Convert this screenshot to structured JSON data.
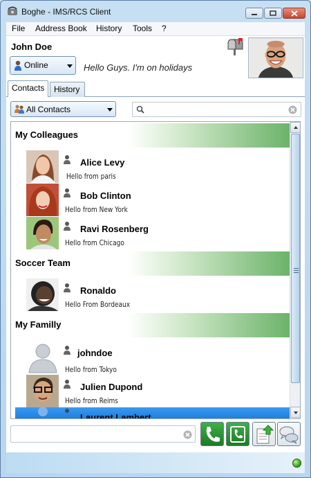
{
  "window": {
    "title": "Boghe - IMS/RCS Client"
  },
  "menu": {
    "items": [
      "File",
      "Address Book",
      "History",
      "Tools",
      "?"
    ]
  },
  "user": {
    "name": "John Doe",
    "presence": "Online",
    "mood": "Hello Guys. I'm on holidays"
  },
  "tabs": [
    "Contacts",
    "History"
  ],
  "filter": {
    "selected": "All Contacts"
  },
  "search": {
    "value": "",
    "placeholder": ""
  },
  "groups": [
    {
      "name": "My Colleagues",
      "contacts": [
        {
          "name": "Alice Levy",
          "note": "Hello from paris"
        },
        {
          "name": "Bob Clinton",
          "note": "Hello from New York"
        },
        {
          "name": "Ravi Rosenberg",
          "note": "Hello from Chicago"
        }
      ]
    },
    {
      "name": "Soccer Team",
      "contacts": [
        {
          "name": "Ronaldo",
          "note": "Hello From Bordeaux"
        }
      ]
    },
    {
      "name": "My Familly",
      "contacts": [
        {
          "name": "johndoe",
          "note": "Hello from Tokyo"
        },
        {
          "name": "Julien Dupond",
          "note": "Hello from Reims"
        },
        {
          "name": "Laurent Lambert",
          "note": ""
        }
      ]
    }
  ],
  "composer": {
    "value": ""
  },
  "icons": [
    "mailbox-icon",
    "phone-icon",
    "video-call-icon",
    "file-upload-icon",
    "chat-icon",
    "status-led-icon"
  ],
  "colors": {
    "group_header": "#6bb36a",
    "selection": "#1e7fe0",
    "status_online": "#2f9a14"
  }
}
